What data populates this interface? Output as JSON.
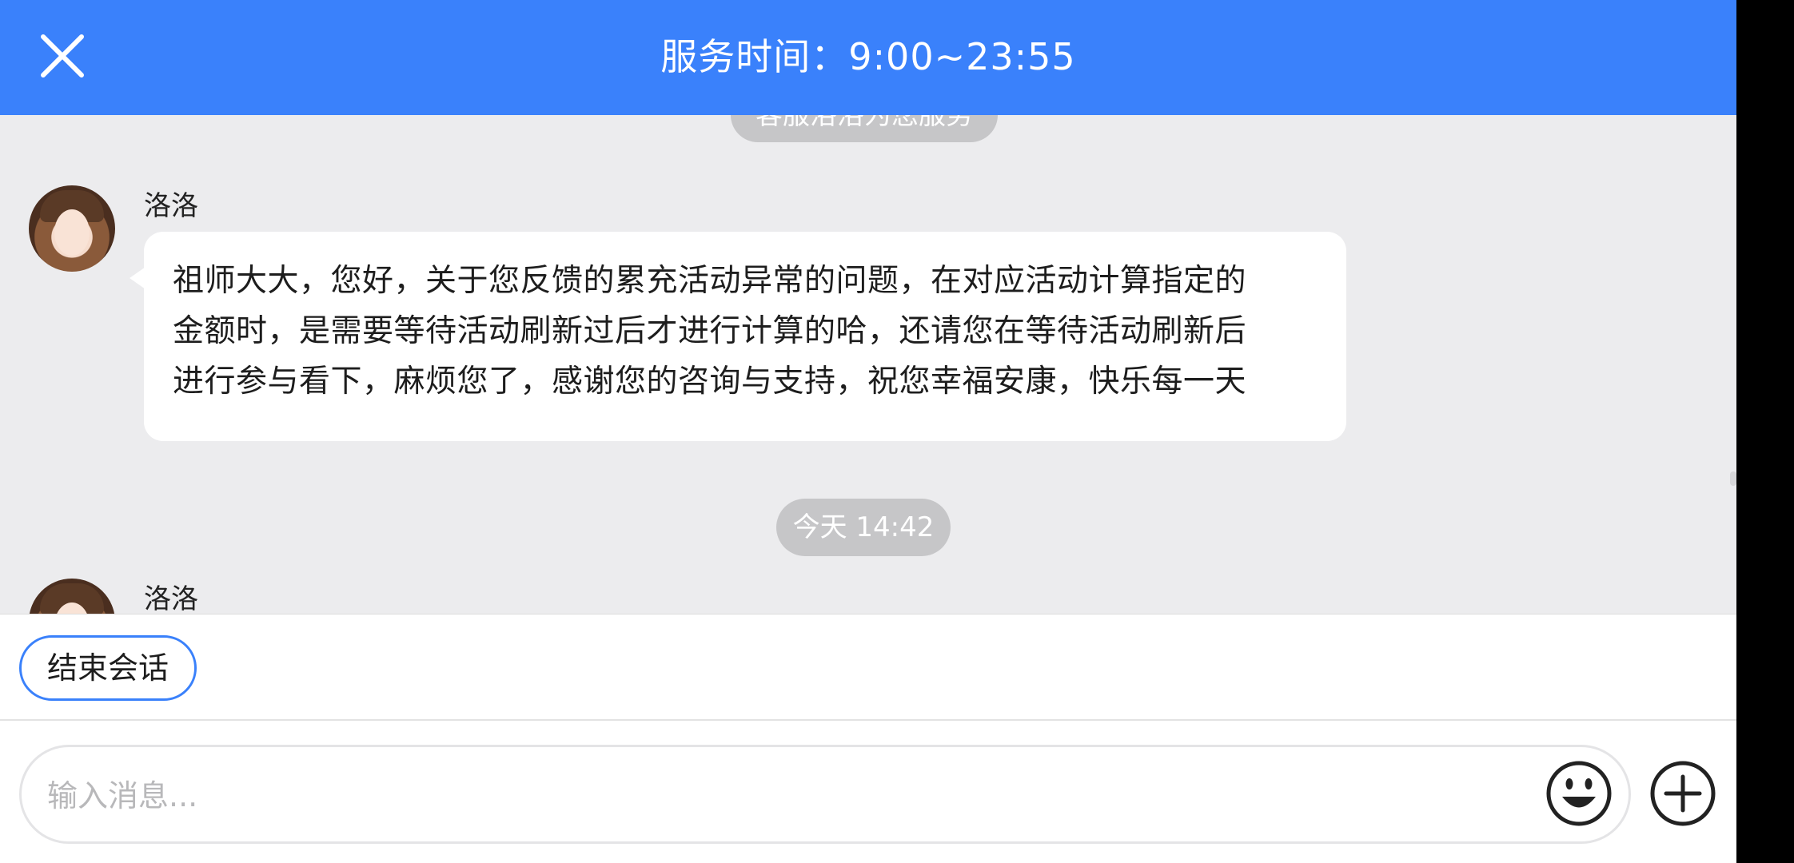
{
  "header": {
    "title": "服务时间：9:00~23:55",
    "close_icon": "close-icon",
    "background_color": "#3a81fb"
  },
  "chat": {
    "top_timestamp": "客服洛洛为您服务",
    "messages": [
      {
        "sender": "洛洛",
        "lines": [
          "祖师大大，您好，关于您反馈的累充活动异常的问题，在对应活动计算指定的",
          "金额时，是需要等待活动刷新过后才进行计算的哈，还请您在等待活动刷新后",
          "进行参与看下，麻烦您了，感谢您的咨询与支持，祝您幸福安康，快乐每一天"
        ]
      }
    ],
    "today_timestamp": "今天 14:42",
    "second_sender": "洛洛"
  },
  "actions": {
    "end_session_label": "结束会话"
  },
  "input": {
    "placeholder": "输入消息...",
    "emoji_icon": "emoji-icon",
    "plus_icon": "plus-icon"
  }
}
